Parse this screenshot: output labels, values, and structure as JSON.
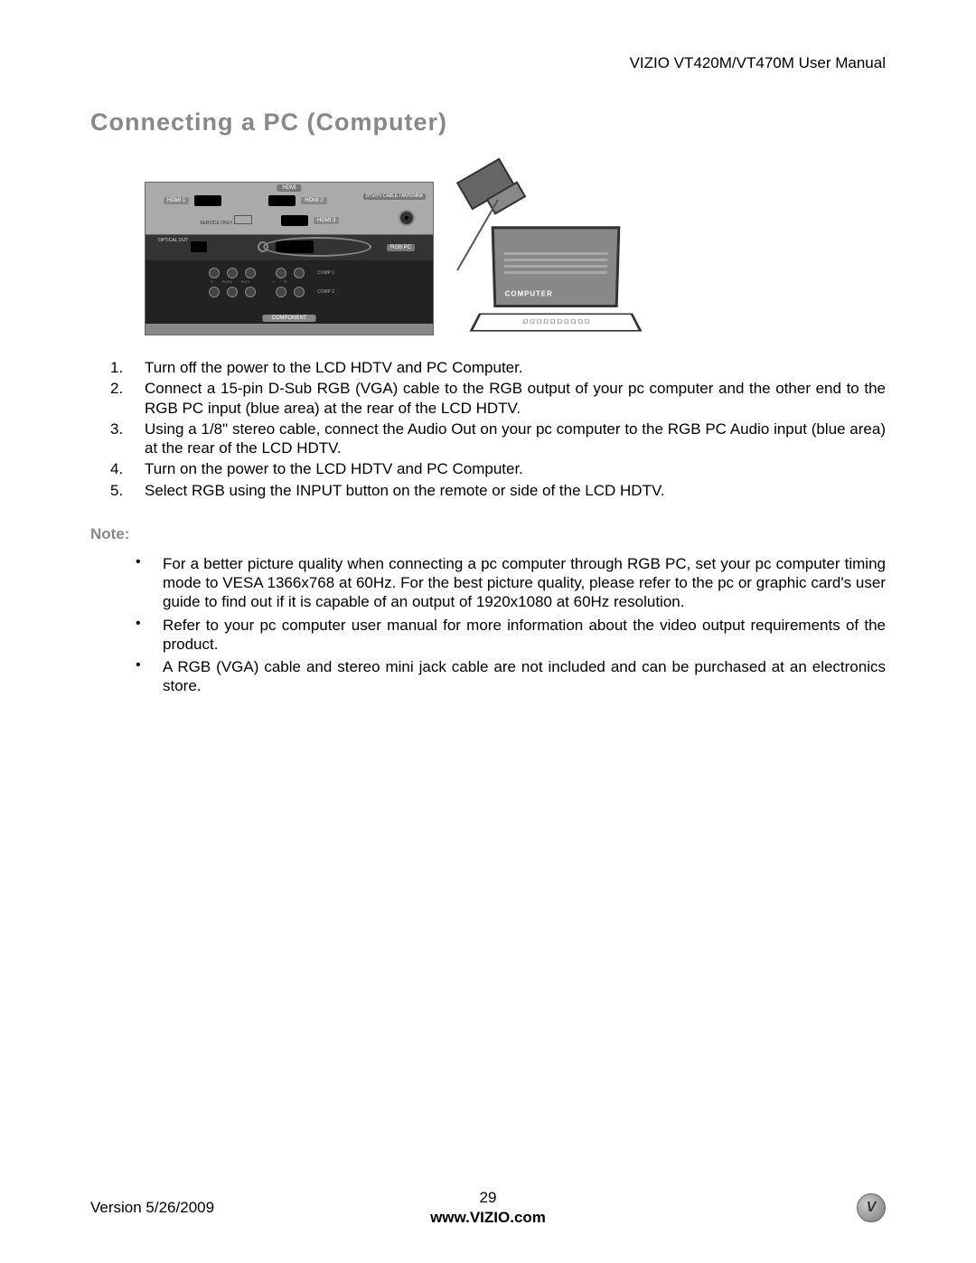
{
  "header": {
    "manual_title": "VIZIO VT420M/VT470M User Manual"
  },
  "section": {
    "title": "Connecting a PC (Computer)"
  },
  "tv_panel": {
    "hdmi_label": "HDMI",
    "hdmi1": "HDMI 1",
    "hdmi2": "HDMI 2",
    "hdmi3": "HDMI 3",
    "service": "SERVICE ONLY",
    "optical": "OPTICAL OUT",
    "rgb_pc": "RGB PC",
    "antenna": "DTV/TV CABLE / ANTENNA",
    "comp1": "COMP 1",
    "comp2": "COMP 2",
    "component": "COMPONENT",
    "y": "Y",
    "pb": "Pb/Cb",
    "pr": "Pr/Cr",
    "l": "L",
    "r": "R"
  },
  "laptop": {
    "label": "COMPUTER"
  },
  "instructions": [
    {
      "num": "1.",
      "text": "Turn off the power to the LCD HDTV and PC Computer."
    },
    {
      "num": "2.",
      "text": "Connect a 15-pin D-Sub RGB (VGA) cable to the RGB output of your pc computer and the other end to the RGB PC input (blue area) at the rear of the LCD HDTV."
    },
    {
      "num": "3.",
      "text": "Using a 1/8\" stereo cable, connect the Audio Out on your pc computer to the RGB PC Audio input (blue area) at the rear of the LCD HDTV."
    },
    {
      "num": "4.",
      "text": "Turn on the power to the LCD HDTV and PC Computer."
    },
    {
      "num": "5.",
      "text": "Select RGB using the INPUT button on the remote or side of the LCD HDTV."
    }
  ],
  "note": {
    "label": "Note:",
    "bullets": [
      "For a better picture quality when connecting a pc computer through RGB PC, set your pc computer timing mode to VESA 1366x768 at 60Hz.  For the best picture quality, please refer to the pc or graphic card's user guide to find out if it is capable of an output of 1920x1080 at 60Hz resolution.",
      "Refer to your pc computer user manual for more information about the video output requirements of the product.",
      "A RGB (VGA) cable and stereo mini jack cable are not included and can be purchased at an electronics store."
    ]
  },
  "footer": {
    "version": "Version 5/26/2009",
    "page": "29",
    "url": "www.VIZIO.com",
    "logo": "V"
  }
}
